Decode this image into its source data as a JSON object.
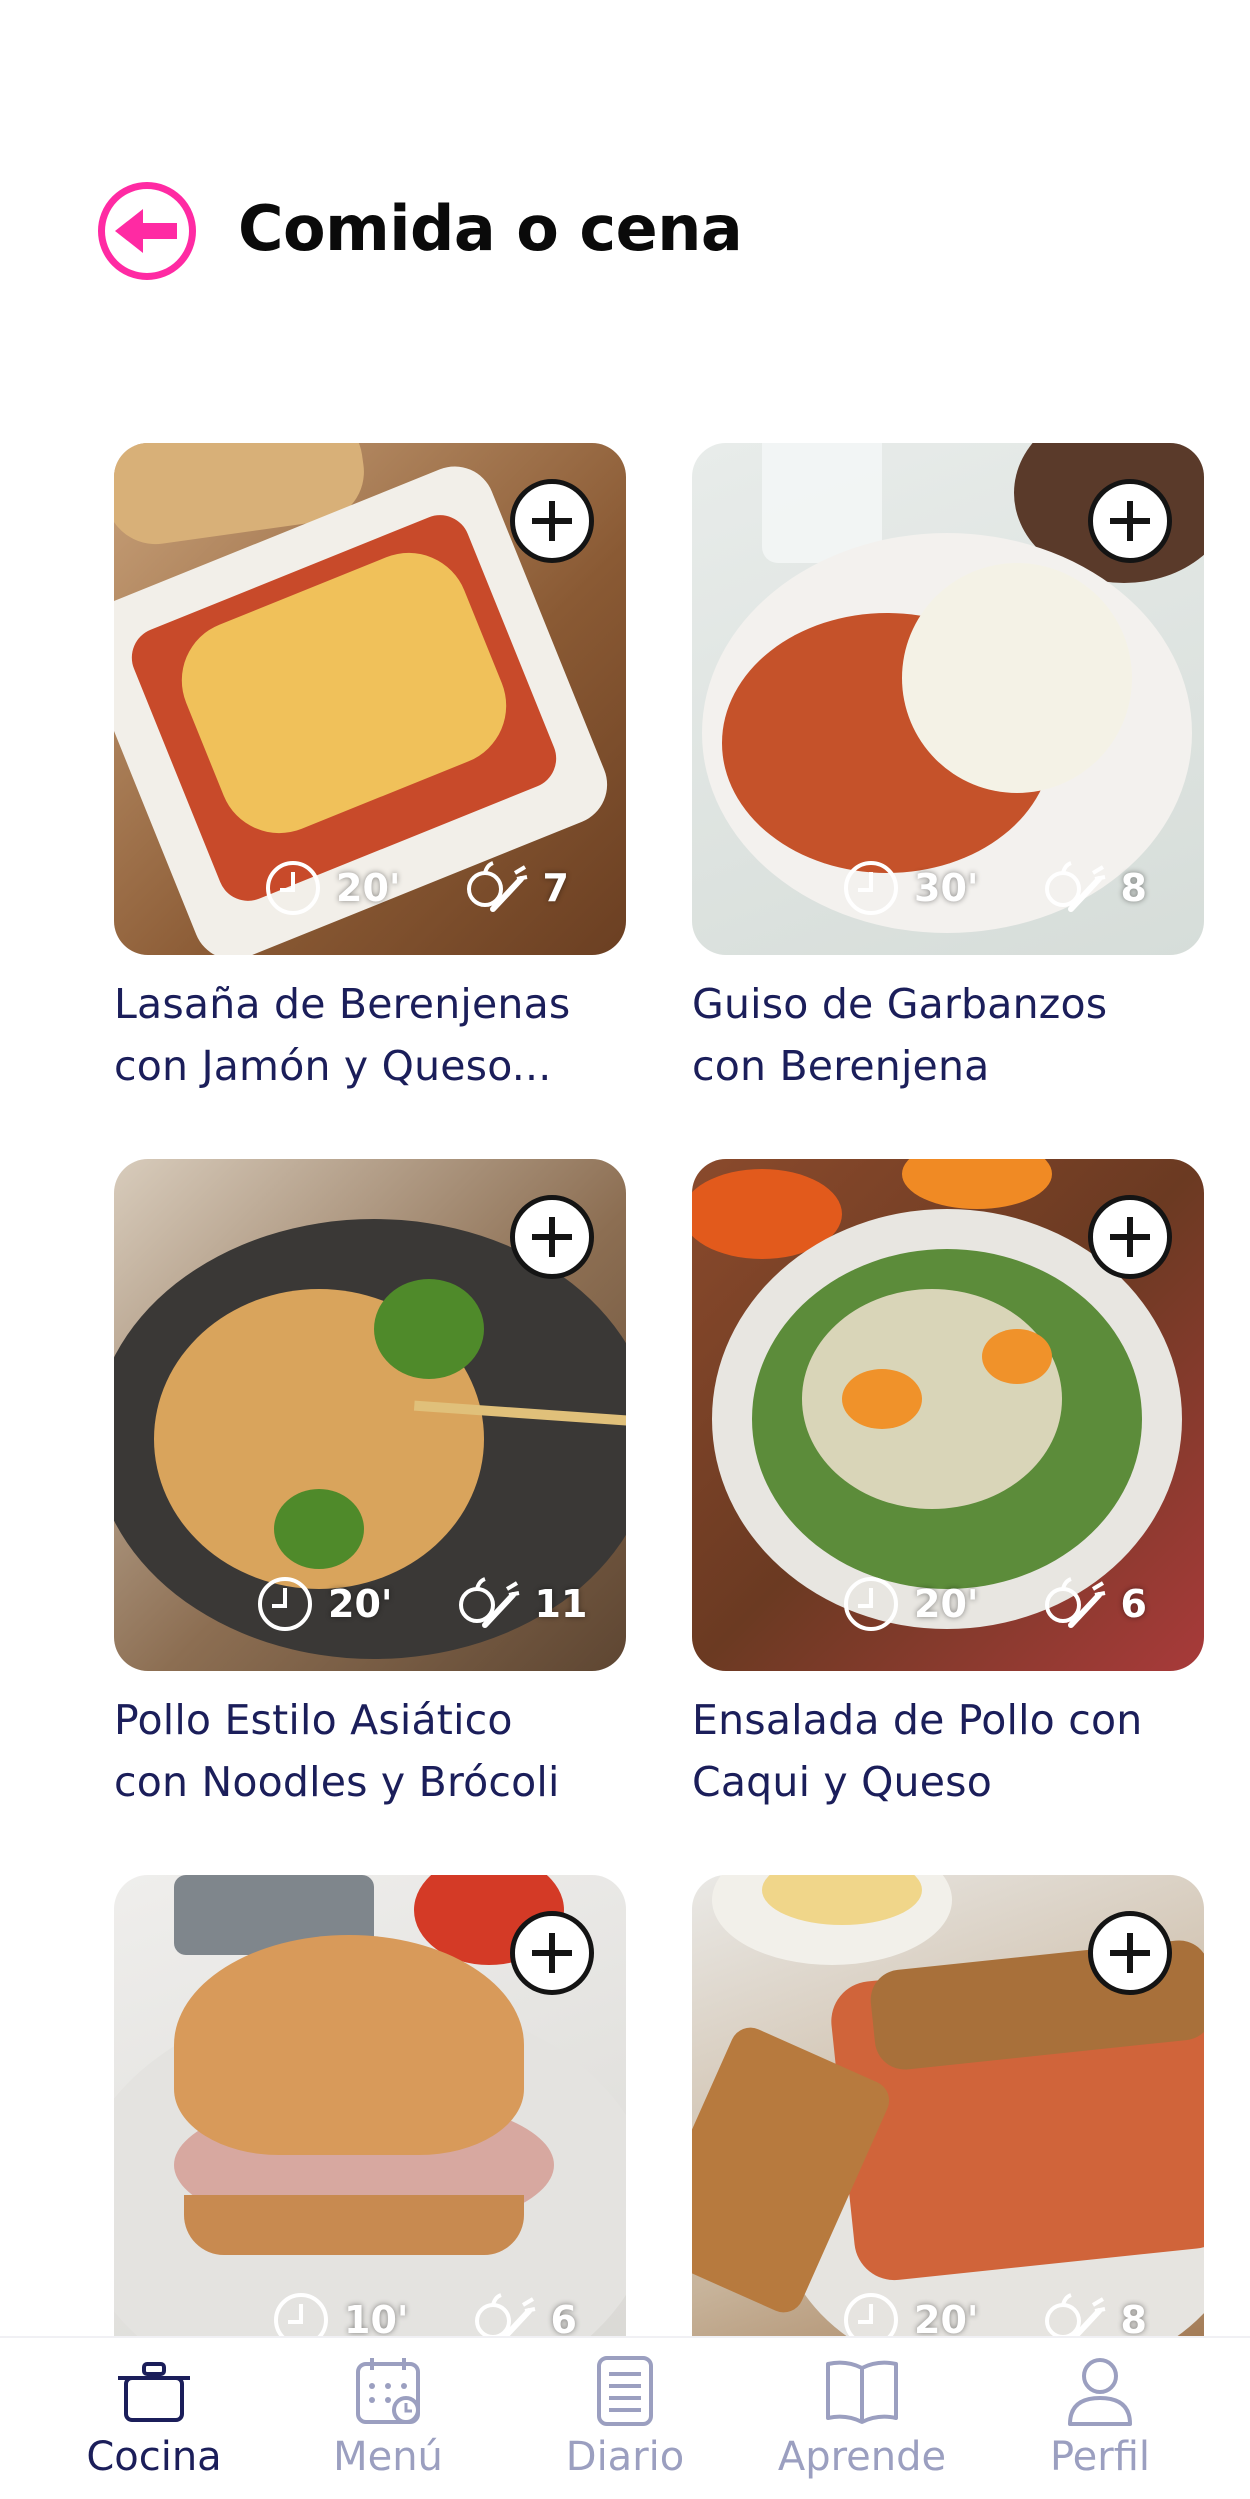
{
  "header": {
    "title": "Comida o cena"
  },
  "recipes": [
    {
      "title_line1": "Lasaña de Berenjenas",
      "title_line2": "con Jamón y Queso...",
      "time": "20'",
      "ingredients": "7"
    },
    {
      "title_line1": "Guiso de Garbanzos",
      "title_line2": "con Berenjena",
      "time": "30'",
      "ingredients": "8"
    },
    {
      "title_line1": "Pollo Estilo Asiático",
      "title_line2": "con Noodles y Brócoli",
      "time": "20'",
      "ingredients": "11"
    },
    {
      "title_line1": "Ensalada de Pollo con",
      "title_line2": "Caqui y Queso",
      "time": "20'",
      "ingredients": "6"
    },
    {
      "title_line1": "",
      "title_line2": "",
      "time": "10'",
      "ingredients": "6"
    },
    {
      "title_line1": "",
      "title_line2": "",
      "time": "20'",
      "ingredients": "8"
    }
  ],
  "nav": {
    "items": [
      {
        "label": "Cocina",
        "icon": "pot-icon",
        "active": true
      },
      {
        "label": "Menú",
        "icon": "calendar-icon",
        "active": false
      },
      {
        "label": "Diario",
        "icon": "notebook-icon",
        "active": false
      },
      {
        "label": "Aprende",
        "icon": "book-icon",
        "active": false
      },
      {
        "label": "Perfil",
        "icon": "user-icon",
        "active": false
      }
    ]
  },
  "colors": {
    "accent": "#ff2aa3",
    "title_text": "#1b1e5a",
    "inactive_nav": "#9b9fc0"
  }
}
